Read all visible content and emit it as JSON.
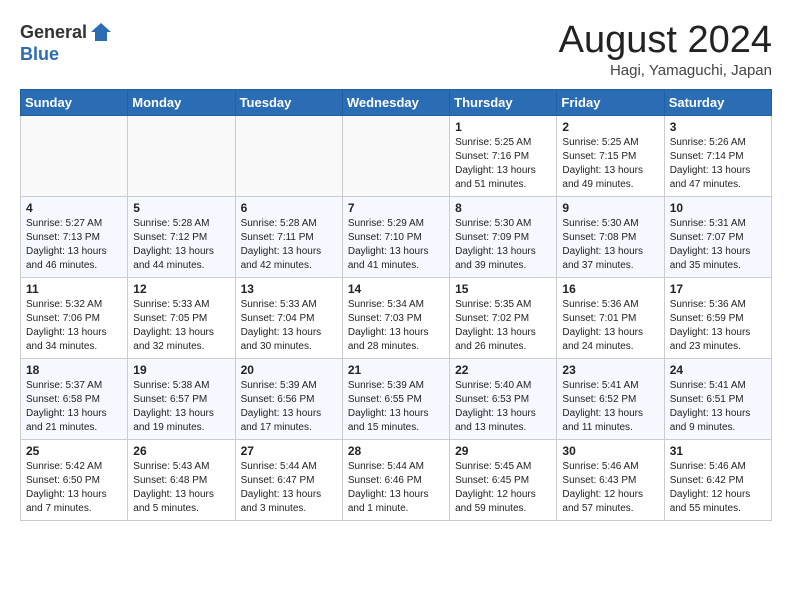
{
  "header": {
    "logo_general": "General",
    "logo_blue": "Blue",
    "month_title": "August 2024",
    "location": "Hagi, Yamaguchi, Japan"
  },
  "weekdays": [
    "Sunday",
    "Monday",
    "Tuesday",
    "Wednesday",
    "Thursday",
    "Friday",
    "Saturday"
  ],
  "weeks": [
    [
      {
        "day": "",
        "info": ""
      },
      {
        "day": "",
        "info": ""
      },
      {
        "day": "",
        "info": ""
      },
      {
        "day": "",
        "info": ""
      },
      {
        "day": "1",
        "info": "Sunrise: 5:25 AM\nSunset: 7:16 PM\nDaylight: 13 hours\nand 51 minutes."
      },
      {
        "day": "2",
        "info": "Sunrise: 5:25 AM\nSunset: 7:15 PM\nDaylight: 13 hours\nand 49 minutes."
      },
      {
        "day": "3",
        "info": "Sunrise: 5:26 AM\nSunset: 7:14 PM\nDaylight: 13 hours\nand 47 minutes."
      }
    ],
    [
      {
        "day": "4",
        "info": "Sunrise: 5:27 AM\nSunset: 7:13 PM\nDaylight: 13 hours\nand 46 minutes."
      },
      {
        "day": "5",
        "info": "Sunrise: 5:28 AM\nSunset: 7:12 PM\nDaylight: 13 hours\nand 44 minutes."
      },
      {
        "day": "6",
        "info": "Sunrise: 5:28 AM\nSunset: 7:11 PM\nDaylight: 13 hours\nand 42 minutes."
      },
      {
        "day": "7",
        "info": "Sunrise: 5:29 AM\nSunset: 7:10 PM\nDaylight: 13 hours\nand 41 minutes."
      },
      {
        "day": "8",
        "info": "Sunrise: 5:30 AM\nSunset: 7:09 PM\nDaylight: 13 hours\nand 39 minutes."
      },
      {
        "day": "9",
        "info": "Sunrise: 5:30 AM\nSunset: 7:08 PM\nDaylight: 13 hours\nand 37 minutes."
      },
      {
        "day": "10",
        "info": "Sunrise: 5:31 AM\nSunset: 7:07 PM\nDaylight: 13 hours\nand 35 minutes."
      }
    ],
    [
      {
        "day": "11",
        "info": "Sunrise: 5:32 AM\nSunset: 7:06 PM\nDaylight: 13 hours\nand 34 minutes."
      },
      {
        "day": "12",
        "info": "Sunrise: 5:33 AM\nSunset: 7:05 PM\nDaylight: 13 hours\nand 32 minutes."
      },
      {
        "day": "13",
        "info": "Sunrise: 5:33 AM\nSunset: 7:04 PM\nDaylight: 13 hours\nand 30 minutes."
      },
      {
        "day": "14",
        "info": "Sunrise: 5:34 AM\nSunset: 7:03 PM\nDaylight: 13 hours\nand 28 minutes."
      },
      {
        "day": "15",
        "info": "Sunrise: 5:35 AM\nSunset: 7:02 PM\nDaylight: 13 hours\nand 26 minutes."
      },
      {
        "day": "16",
        "info": "Sunrise: 5:36 AM\nSunset: 7:01 PM\nDaylight: 13 hours\nand 24 minutes."
      },
      {
        "day": "17",
        "info": "Sunrise: 5:36 AM\nSunset: 6:59 PM\nDaylight: 13 hours\nand 23 minutes."
      }
    ],
    [
      {
        "day": "18",
        "info": "Sunrise: 5:37 AM\nSunset: 6:58 PM\nDaylight: 13 hours\nand 21 minutes."
      },
      {
        "day": "19",
        "info": "Sunrise: 5:38 AM\nSunset: 6:57 PM\nDaylight: 13 hours\nand 19 minutes."
      },
      {
        "day": "20",
        "info": "Sunrise: 5:39 AM\nSunset: 6:56 PM\nDaylight: 13 hours\nand 17 minutes."
      },
      {
        "day": "21",
        "info": "Sunrise: 5:39 AM\nSunset: 6:55 PM\nDaylight: 13 hours\nand 15 minutes."
      },
      {
        "day": "22",
        "info": "Sunrise: 5:40 AM\nSunset: 6:53 PM\nDaylight: 13 hours\nand 13 minutes."
      },
      {
        "day": "23",
        "info": "Sunrise: 5:41 AM\nSunset: 6:52 PM\nDaylight: 13 hours\nand 11 minutes."
      },
      {
        "day": "24",
        "info": "Sunrise: 5:41 AM\nSunset: 6:51 PM\nDaylight: 13 hours\nand 9 minutes."
      }
    ],
    [
      {
        "day": "25",
        "info": "Sunrise: 5:42 AM\nSunset: 6:50 PM\nDaylight: 13 hours\nand 7 minutes."
      },
      {
        "day": "26",
        "info": "Sunrise: 5:43 AM\nSunset: 6:48 PM\nDaylight: 13 hours\nand 5 minutes."
      },
      {
        "day": "27",
        "info": "Sunrise: 5:44 AM\nSunset: 6:47 PM\nDaylight: 13 hours\nand 3 minutes."
      },
      {
        "day": "28",
        "info": "Sunrise: 5:44 AM\nSunset: 6:46 PM\nDaylight: 13 hours\nand 1 minute."
      },
      {
        "day": "29",
        "info": "Sunrise: 5:45 AM\nSunset: 6:45 PM\nDaylight: 12 hours\nand 59 minutes."
      },
      {
        "day": "30",
        "info": "Sunrise: 5:46 AM\nSunset: 6:43 PM\nDaylight: 12 hours\nand 57 minutes."
      },
      {
        "day": "31",
        "info": "Sunrise: 5:46 AM\nSunset: 6:42 PM\nDaylight: 12 hours\nand 55 minutes."
      }
    ]
  ]
}
